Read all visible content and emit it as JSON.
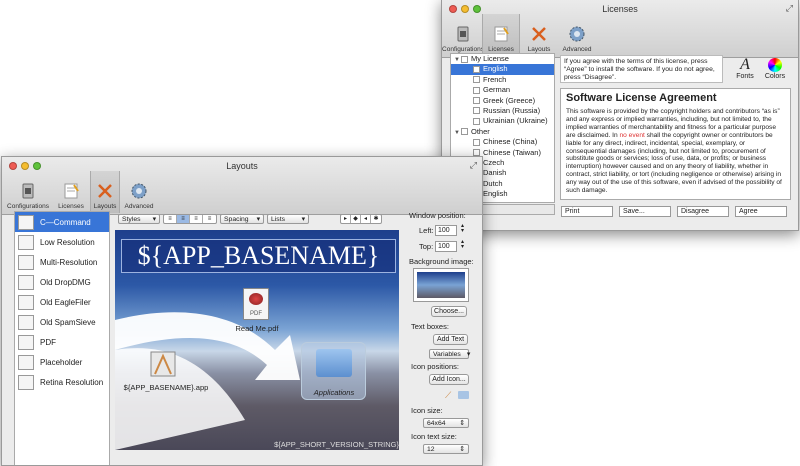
{
  "licenses_window": {
    "title": "Licenses",
    "toolbar": [
      "Configurations",
      "Licenses",
      "Layouts",
      "Advanced"
    ],
    "tree": [
      {
        "label": "My License",
        "type": "group"
      },
      {
        "label": "English",
        "type": "item",
        "selected": true
      },
      {
        "label": "French",
        "type": "item"
      },
      {
        "label": "German",
        "type": "item"
      },
      {
        "label": "Greek (Greece)",
        "type": "item"
      },
      {
        "label": "Russian (Russia)",
        "type": "item"
      },
      {
        "label": "Ukrainian (Ukraine)",
        "type": "item"
      },
      {
        "label": "Other",
        "type": "group"
      },
      {
        "label": "Chinese (China)",
        "type": "item"
      },
      {
        "label": "Chinese (Taiwan)",
        "type": "item"
      },
      {
        "label": "Czech",
        "type": "item"
      },
      {
        "label": "Danish",
        "type": "item"
      },
      {
        "label": "Dutch",
        "type": "item"
      },
      {
        "label": "English",
        "type": "item"
      }
    ],
    "tree_bar": "✱ ▾",
    "note": "If you agree with the terms of this license, press “Agree” to install the software. If you do not agree, press “Disagree”.",
    "fonts_label": "Fonts",
    "colors_label": "Colors",
    "agreement_title": "Software License Agreement",
    "agreement_p1": "This software is provided by the copyright holders and contributors “as is” and any express or implied warranties, including, but not limited to, the implied warranties of merchantability and fitness for a particular purpose are disclaimed. In ",
    "agreement_red": "no event",
    "agreement_p2": " shall the copyright owner or contributors be liable for any direct, indirect, incidental, special, exemplary, or consequential damages (including, but not limited to, procurement of substitute goods or services; loss of use, data, or profits; or business interruption) however caused and on any theory of liability, whether in contract, strict liability, or tort (including negligence or otherwise) arising in any way out of the use of this software, even if advised of the possibility of such damage.",
    "fields": [
      "Print",
      "Save...",
      "Disagree",
      "Agree"
    ]
  },
  "layouts_window": {
    "title": "Layouts",
    "toolbar": [
      "Configurations",
      "Licenses",
      "Layouts",
      "Advanced"
    ],
    "sidebar": [
      "C—Command",
      "Low Resolution",
      "Multi-Resolution",
      "Old DropDMG",
      "Old EagleFiler",
      "Old SpamSieve",
      "PDF",
      "Placeholder",
      "Retina Resolution"
    ],
    "bar": {
      "styles": "Styles",
      "spacing": "Spacing",
      "lists": "Lists"
    },
    "canvas": {
      "app_title": "${APP_BASENAME}",
      "readme_label": "Read Me.pdf",
      "pdf_badge": "PDF",
      "app_label": "${APP_BASENAME}.app",
      "applications_label": "Applications",
      "version_label": "${APP_SHORT_VERSION_STRING}"
    },
    "panel": {
      "window_position": "Window position:",
      "left_label": "Left:",
      "left_value": "100",
      "top_label": "Top:",
      "top_value": "100",
      "background_image": "Background image:",
      "choose": "Choose...",
      "text_boxes": "Text boxes:",
      "add_text": "Add Text",
      "variables": "Variables",
      "icon_positions": "Icon positions:",
      "add_icon": "Add Icon...",
      "icon_size": "Icon size:",
      "icon_size_value": "64x64",
      "icon_text_size": "Icon text size:",
      "icon_text_size_value": "12"
    }
  },
  "colors": {
    "selection": "#3875d7",
    "sky": "#2c58a6",
    "red_text": "#dd3333"
  }
}
